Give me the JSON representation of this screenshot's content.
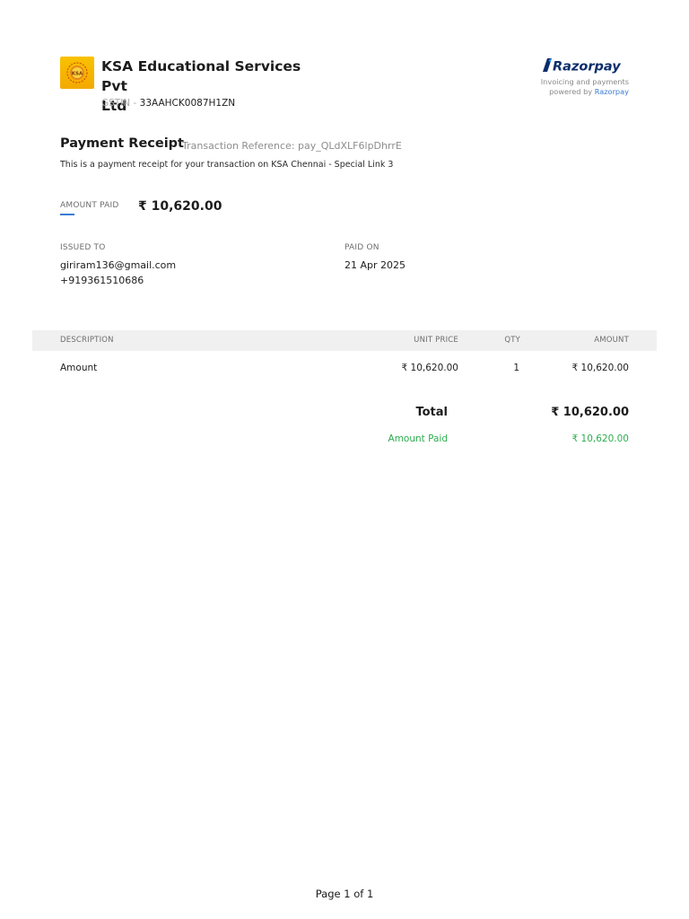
{
  "merchant": {
    "name_line1": "KSA Educational Services Pvt",
    "name_line2": "Ltd",
    "logo_text": "KSA",
    "gstin_label": "GSTIN -",
    "gstin_value": "33AAHCK0087H1ZN"
  },
  "provider": {
    "logo_text": "Razorpay",
    "tagline": "Invoicing and payments",
    "powered_prefix": "powered by",
    "powered_brand": "Razorpay",
    "accent_color": "#3a7bd5"
  },
  "receipt": {
    "title": "Payment Receipt",
    "transaction_reference": "Transaction Reference: pay_QLdXLF6lpDhrrE",
    "description": "This is a payment receipt for your transaction on KSA Chennai - Special Link 3",
    "amount_paid_label": "AMOUNT PAID",
    "amount_paid_value": "₹ 10,620.00"
  },
  "issued_to": {
    "label": "ISSUED TO",
    "email": "giriram136@gmail.com",
    "phone": "+919361510686"
  },
  "paid_on": {
    "label": "PAID ON",
    "date": "21 Apr 2025"
  },
  "table": {
    "headers": {
      "description": "DESCRIPTION",
      "unit_price": "UNIT PRICE",
      "qty": "QTY",
      "amount": "AMOUNT"
    },
    "rows": [
      {
        "description": "Amount",
        "unit_price": "₹ 10,620.00",
        "qty": "1",
        "amount": "₹ 10,620.00"
      }
    ]
  },
  "totals": {
    "total_label": "Total",
    "total_value": "₹ 10,620.00",
    "amount_paid_label": "Amount Paid",
    "amount_paid_value": "₹ 10,620.00",
    "paid_color": "#2dae4f"
  },
  "footer": {
    "page_text": "Page 1 of 1"
  }
}
